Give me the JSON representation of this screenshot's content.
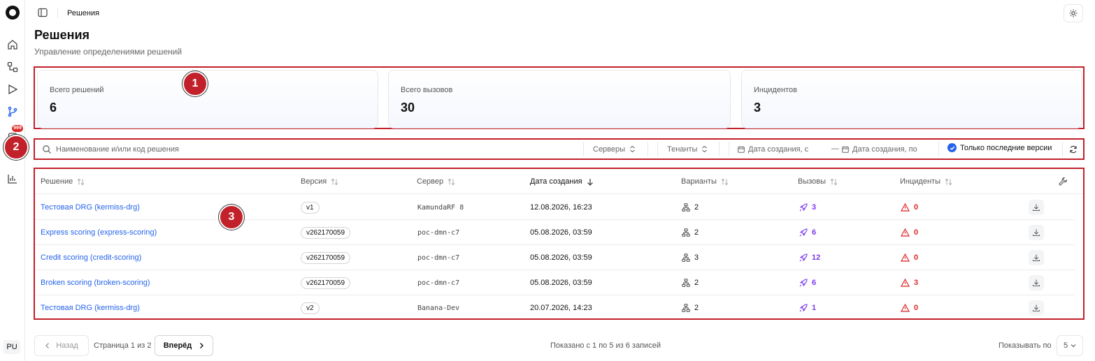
{
  "sidebar": {
    "badge": "999",
    "avatar": "PU",
    "icons": [
      "home-icon",
      "workflow-icon",
      "play-icon",
      "branch-icon",
      "notifications-icon",
      "chart-icon"
    ]
  },
  "topbar": {
    "breadcrumb": "Решения"
  },
  "page": {
    "title": "Решения",
    "subtitle": "Управление определениями решений"
  },
  "stats": [
    {
      "label": "Всего решений",
      "value": "6"
    },
    {
      "label": "Всего вызовов",
      "value": "30"
    },
    {
      "label": "Инцидентов",
      "value": "3"
    }
  ],
  "markers": [
    "1",
    "2",
    "3"
  ],
  "filters": {
    "search_placeholder": "Наименование и/или код решения",
    "servers": "Серверы",
    "tenants": "Тенанты",
    "date_from": "Дата создания, с",
    "dash": "—",
    "date_to": "Дата создания, по",
    "latest_only": "Только последние версии"
  },
  "table": {
    "columns": {
      "decision": "Решение",
      "version": "Версия",
      "server": "Сервер",
      "created": "Дата создания",
      "variants": "Варианты",
      "calls": "Вызовы",
      "incidents": "Инциденты"
    },
    "rows": [
      {
        "decision": "Тестовая DRG (kermiss-drg)",
        "version": "v1",
        "server": "KamundaRF 8",
        "created": "12.08.2026, 16:23",
        "variants": "2",
        "calls": "3",
        "incidents": "0"
      },
      {
        "decision": "Express scoring (express-scoring)",
        "version": "v262170059",
        "server": "poc-dmn-c7",
        "created": "05.08.2026, 03:59",
        "variants": "2",
        "calls": "6",
        "incidents": "0"
      },
      {
        "decision": "Credit scoring (credit-scoring)",
        "version": "v262170059",
        "server": "poc-dmn-c7",
        "created": "05.08.2026, 03:59",
        "variants": "3",
        "calls": "12",
        "incidents": "0"
      },
      {
        "decision": "Broken scoring (broken-scoring)",
        "version": "v262170059",
        "server": "poc-dmn-c7",
        "created": "05.08.2026, 03:59",
        "variants": "2",
        "calls": "6",
        "incidents": "3"
      },
      {
        "decision": "Тестовая DRG (kermiss-drg)",
        "version": "v2",
        "server": "Banana-Dev",
        "created": "20.07.2026, 14:23",
        "variants": "2",
        "calls": "1",
        "incidents": "0"
      }
    ]
  },
  "pagination": {
    "prev": "Назад",
    "page_info": "Страница 1 из 2",
    "next": "Вперёд",
    "shown": "Показано с 1 по 5 из 6 записей",
    "per_page_label": "Показывать по",
    "per_page": "5"
  },
  "colors": {
    "accent": "#2563eb",
    "annotation": "#c2202a",
    "calls": "#7c3aed",
    "incidents": "#dc2626"
  }
}
